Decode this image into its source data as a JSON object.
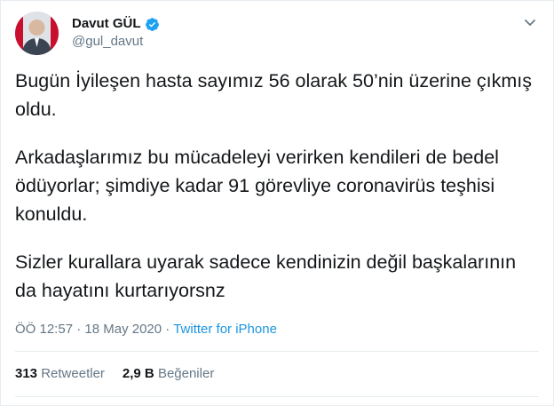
{
  "user": {
    "display_name": "Davut GÜL",
    "handle": "@gul_davut",
    "verified_color": "#1da1f2"
  },
  "tweet": {
    "paragraphs": [
      "Bugün İyileşen hasta sayımız 56 olarak 50’nin üzerine çıkmış oldu.",
      "Arkadaşlarımız bu mücadeleyi verirken kendileri de bedel ödüyorlar; şimdiye kadar 91 görevliye coronavirüs teşhisi konuldu.",
      "Sizler kurallara uyarak sadece kendinizin değil başkalarının da hayatını kurtarıyorsnz"
    ],
    "time": "ÖÖ 12:57",
    "date": "18 May 2020",
    "separator": " · ",
    "source": "Twitter for iPhone"
  },
  "stats": {
    "retweets_count": "313",
    "retweets_label": "Retweetler",
    "likes_count": "2,9 B",
    "likes_label": "Beğeniler"
  },
  "icons": {
    "verified": "verified-badge-icon",
    "menu": "chevron-down-icon"
  }
}
